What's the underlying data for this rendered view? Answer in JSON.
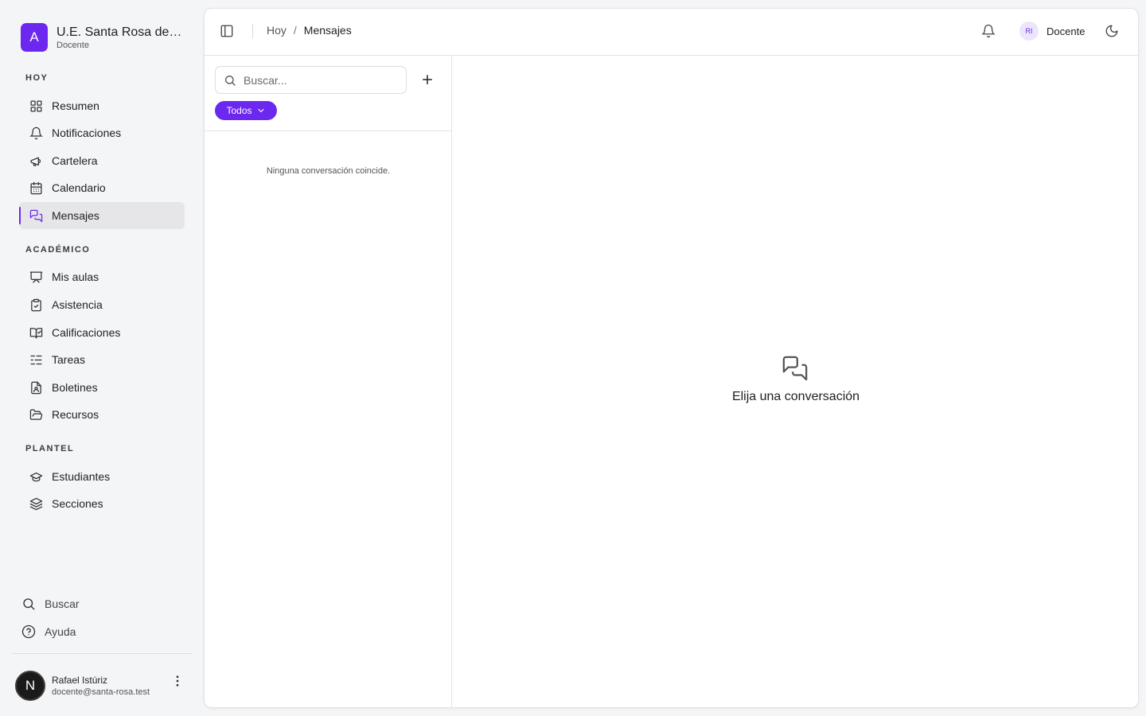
{
  "brand": {
    "logo_letter": "A",
    "name": "U.E. Santa Rosa de Li...",
    "role": "Docente"
  },
  "sidebar": {
    "sections": [
      {
        "label": "HOY"
      },
      {
        "label": "ACADÉMICO"
      },
      {
        "label": "PLANTEL"
      }
    ],
    "items": [
      {
        "label": "Resumen",
        "icon": "grid-icon"
      },
      {
        "label": "Notificaciones",
        "icon": "bell-icon"
      },
      {
        "label": "Cartelera",
        "icon": "megaphone-icon"
      },
      {
        "label": "Calendario",
        "icon": "calendar-icon"
      },
      {
        "label": "Mensajes",
        "icon": "messages-icon",
        "active": true
      },
      {
        "label": "Mis aulas",
        "icon": "presentation-icon"
      },
      {
        "label": "Asistencia",
        "icon": "clipboard-check-icon"
      },
      {
        "label": "Calificaciones",
        "icon": "book-check-icon"
      },
      {
        "label": "Tareas",
        "icon": "list-check-icon"
      },
      {
        "label": "Boletines",
        "icon": "file-user-icon"
      },
      {
        "label": "Recursos",
        "icon": "folder-open-icon"
      },
      {
        "label": "Estudiantes",
        "icon": "graduation-cap-icon"
      },
      {
        "label": "Secciones",
        "icon": "layers-icon"
      }
    ],
    "bottom": {
      "search_label": "Buscar",
      "help_label": "Ayuda"
    }
  },
  "user": {
    "avatar_letter": "N",
    "name": "Rafael Istúriz",
    "email": "docente@santa-rosa.test"
  },
  "header": {
    "breadcrumb_parent": "Hoy",
    "breadcrumb_separator": "/",
    "breadcrumb_current": "Mensajes",
    "profile_initials": "RI",
    "profile_name": "Docente"
  },
  "conversations": {
    "search_placeholder": "Buscar...",
    "search_value": "",
    "filter_label": "Todos",
    "empty_message": "Ninguna conversación coincide."
  },
  "detail": {
    "empty_message": "Elija una conversación"
  },
  "colors": {
    "accent": "#6d28f0",
    "background": "#f4f5f7"
  }
}
